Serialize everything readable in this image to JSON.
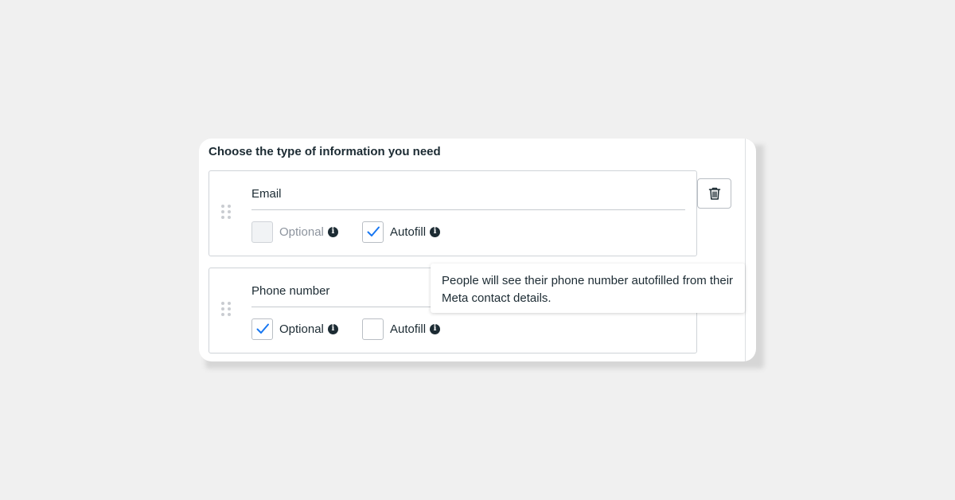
{
  "section_title": "Choose the type of information you need",
  "fields": [
    {
      "label": "Email",
      "optional": {
        "label": "Optional",
        "checked": false,
        "disabled": true
      },
      "autofill": {
        "label": "Autofill",
        "checked": true,
        "disabled": false
      }
    },
    {
      "label": "Phone number",
      "optional": {
        "label": "Optional",
        "checked": true,
        "disabled": false
      },
      "autofill": {
        "label": "Autofill",
        "checked": false,
        "disabled": false
      }
    }
  ],
  "tooltip": {
    "text": "People will see their phone number autofilled from their Meta contact details."
  },
  "icons": {
    "info": "info-icon",
    "delete": "trash-icon",
    "drag": "drag-handle-icon",
    "check": "checkmark-icon"
  },
  "colors": {
    "check_accent": "#1877f2",
    "text": "#1c2b33",
    "muted_text": "#8d949e",
    "border": "#cfd3d8"
  }
}
